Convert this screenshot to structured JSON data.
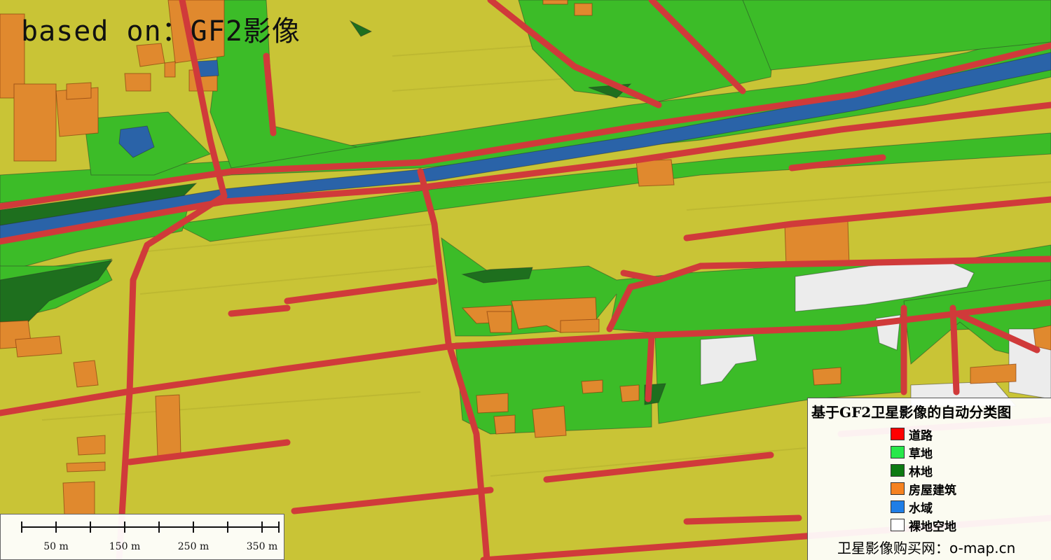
{
  "overlay_title": "based on：GF2影像",
  "legend": {
    "title": "基于GF2卫星影像的自动分类图",
    "items": [
      {
        "label": "道路",
        "color": "#ff0000"
      },
      {
        "label": "草地",
        "color": "#27e84a"
      },
      {
        "label": "林地",
        "color": "#0d7a12"
      },
      {
        "label": "房屋建筑",
        "color": "#f58220"
      },
      {
        "label": "水域",
        "color": "#1f7ee6"
      },
      {
        "label": "裸地空地",
        "color": "#ffffff"
      }
    ],
    "footer": "卫星影像购买网：o-map.cn"
  },
  "scalebar": {
    "labels": [
      "50 m",
      "150 m",
      "250 m",
      "350 m"
    ]
  },
  "colors": {
    "farmland": "#c9c436",
    "grass": "#3cbc28",
    "forest": "#1e6f1e",
    "building": "#e0892e",
    "water": "#2a63a8",
    "road": "#d03a3a",
    "bare": "#ececec"
  }
}
